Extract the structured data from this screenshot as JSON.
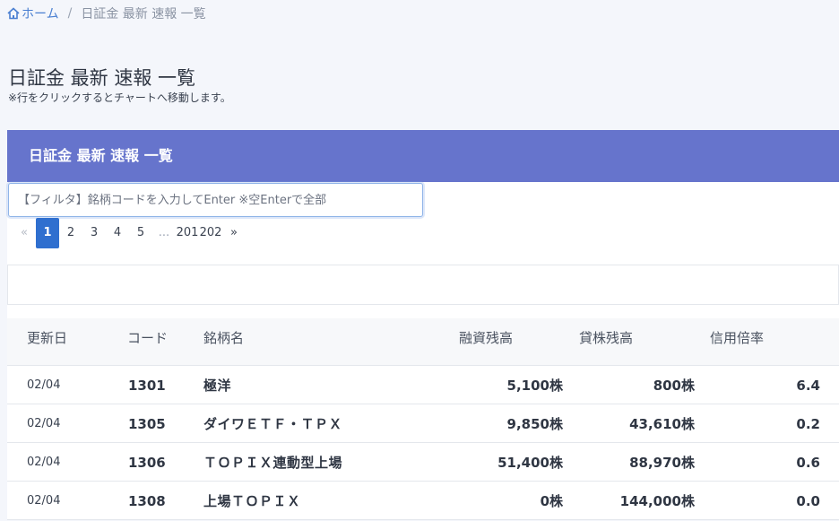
{
  "breadcrumb": {
    "home": "ホーム",
    "separator": "/",
    "current": "日証金 最新 速報 一覧"
  },
  "page": {
    "title": "日証金 最新 速報 一覧",
    "note": "※行をクリックするとチャートへ移動します。"
  },
  "card": {
    "header": "日証金 最新 速報 一覧",
    "filter_placeholder": "【フィルタ】銘柄コードを入力してEnter ※空Enterで全部"
  },
  "pagination": {
    "prev": "«",
    "pages": [
      "1",
      "2",
      "3",
      "4",
      "5"
    ],
    "ellipsis": "...",
    "tail": [
      "201",
      "202"
    ],
    "next": "»",
    "active": "1"
  },
  "table": {
    "columns": [
      "更新日",
      "コード",
      "銘柄名",
      "融資残高",
      "貸株残高",
      "信用倍率"
    ],
    "rows": [
      {
        "date": "02/04",
        "code": "1301",
        "name": "極洋",
        "loan": "5,100株",
        "lend": "800株",
        "ratio": "6.4"
      },
      {
        "date": "02/04",
        "code": "1305",
        "name": "ダイワＥＴＦ・ＴＰＸ",
        "loan": "9,850株",
        "lend": "43,610株",
        "ratio": "0.2"
      },
      {
        "date": "02/04",
        "code": "1306",
        "name": "ＴＯＰＩＸ連動型上場",
        "loan": "51,400株",
        "lend": "88,970株",
        "ratio": "0.6"
      },
      {
        "date": "02/04",
        "code": "1308",
        "name": "上場ＴＯＰＩＸ",
        "loan": "0株",
        "lend": "144,000株",
        "ratio": "0.0"
      }
    ]
  },
  "colors": {
    "header_bg": "#6674cc",
    "active_page": "#2f6fcf",
    "link": "#4a7fd1"
  }
}
